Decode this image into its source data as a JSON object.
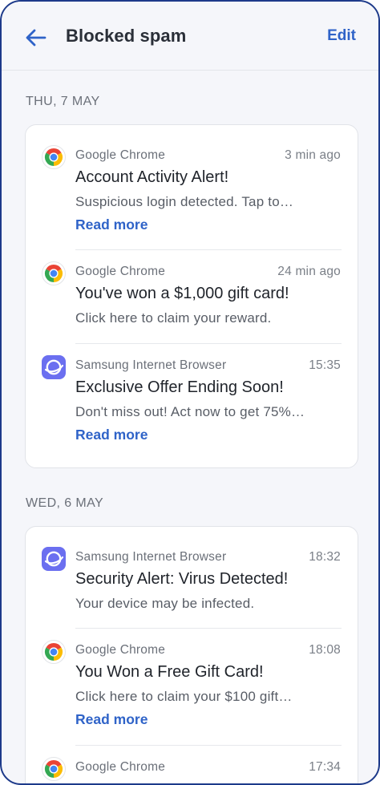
{
  "header": {
    "title": "Blocked spam",
    "edit_label": "Edit"
  },
  "groups": [
    {
      "date": "THU, 7 MAY",
      "items": [
        {
          "app": "Google Chrome",
          "app_icon": "chrome-icon",
          "time": "3 min ago",
          "title": "Account Activity Alert!",
          "body": "Suspicious login detected. Tap to…",
          "read_more": "Read more"
        },
        {
          "app": "Google Chrome",
          "app_icon": "chrome-icon",
          "time": "24 min ago",
          "title": "You've won a $1,000 gift card!",
          "body": "Click here to claim your reward."
        },
        {
          "app": "Samsung Internet Browser",
          "app_icon": "samsung-internet-icon",
          "time": "15:35",
          "title": "Exclusive Offer Ending Soon!",
          "body": "Don't miss out! Act now to get 75%…",
          "read_more": "Read more"
        }
      ]
    },
    {
      "date": "WED, 6 MAY",
      "items": [
        {
          "app": "Samsung Internet Browser",
          "app_icon": "samsung-internet-icon",
          "time": "18:32",
          "title": "Security Alert: Virus Detected!",
          "body": "Your device may be infected."
        },
        {
          "app": "Google Chrome",
          "app_icon": "chrome-icon",
          "time": "18:08",
          "title": "You Won a Free Gift Card!",
          "body": "Click here to claim your $100 gift…",
          "read_more": "Read more"
        },
        {
          "app": "Google Chrome",
          "app_icon": "chrome-icon",
          "time": "17:34"
        }
      ]
    }
  ],
  "colors": {
    "accent": "#2f63c8",
    "frame_border": "#1d3a8a",
    "background": "#f5f6fa",
    "samsung_icon": "#6b6ff0"
  }
}
